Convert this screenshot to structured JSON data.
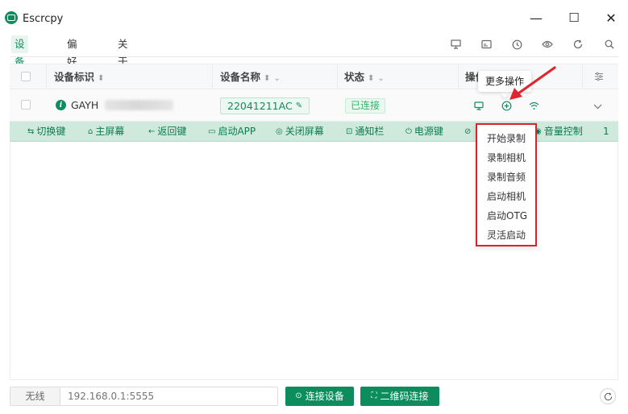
{
  "window": {
    "title": "Escrcpy",
    "controls": {
      "minimize": "—",
      "maximize": "☐",
      "close": "✕"
    },
    "icon": "escrcpy-logo-icon"
  },
  "nav": {
    "items": [
      {
        "label": "设备列表",
        "active": true
      },
      {
        "label": "偏好设置",
        "active": false
      },
      {
        "label": "关于",
        "active": false
      }
    ],
    "toolbar_icons": [
      "projector-icon",
      "cast-icon",
      "history-icon",
      "eye-icon",
      "refresh-icon",
      "search-icon"
    ]
  },
  "table": {
    "headers": {
      "device_id": "设备标识",
      "device_name": "设备名称",
      "status": "状态",
      "actions": "操作"
    },
    "row": {
      "device_id": "GAYH",
      "device_name": "22041211AC",
      "status": "已连接",
      "action_icons": [
        "monitor-icon",
        "plus-circle-icon",
        "wifi-icon"
      ]
    }
  },
  "action_bar": {
    "buttons": [
      {
        "label": "切换键",
        "icon": "switch-icon"
      },
      {
        "label": "主屏幕",
        "icon": "home-icon"
      },
      {
        "label": "返回键",
        "icon": "back-arrow-icon"
      },
      {
        "label": "启动APP",
        "icon": "app-icon"
      },
      {
        "label": "关闭屏幕",
        "icon": "eye-off-icon"
      },
      {
        "label": "通知栏",
        "icon": "notification-icon"
      },
      {
        "label": "电源键",
        "icon": "power-icon"
      },
      {
        "label": "音量控制",
        "icon": "volume-icon"
      }
    ],
    "trailing": "1"
  },
  "tooltip": "更多操作",
  "dropdown": {
    "items": [
      "开始录制",
      "录制相机",
      "录制音频",
      "启动相机",
      "启动OTG",
      "灵活启动"
    ]
  },
  "bottom": {
    "prefix": "无线",
    "placeholder": "192.168.0.1:5555",
    "connect_button": "连接设备",
    "qrcode_button": "二维码连接"
  },
  "colors": {
    "accent": "#0d8c5e",
    "action_bar_bg": "#cfeadc",
    "highlight_border": "#d9232b",
    "status_text": "#2fb36b"
  }
}
